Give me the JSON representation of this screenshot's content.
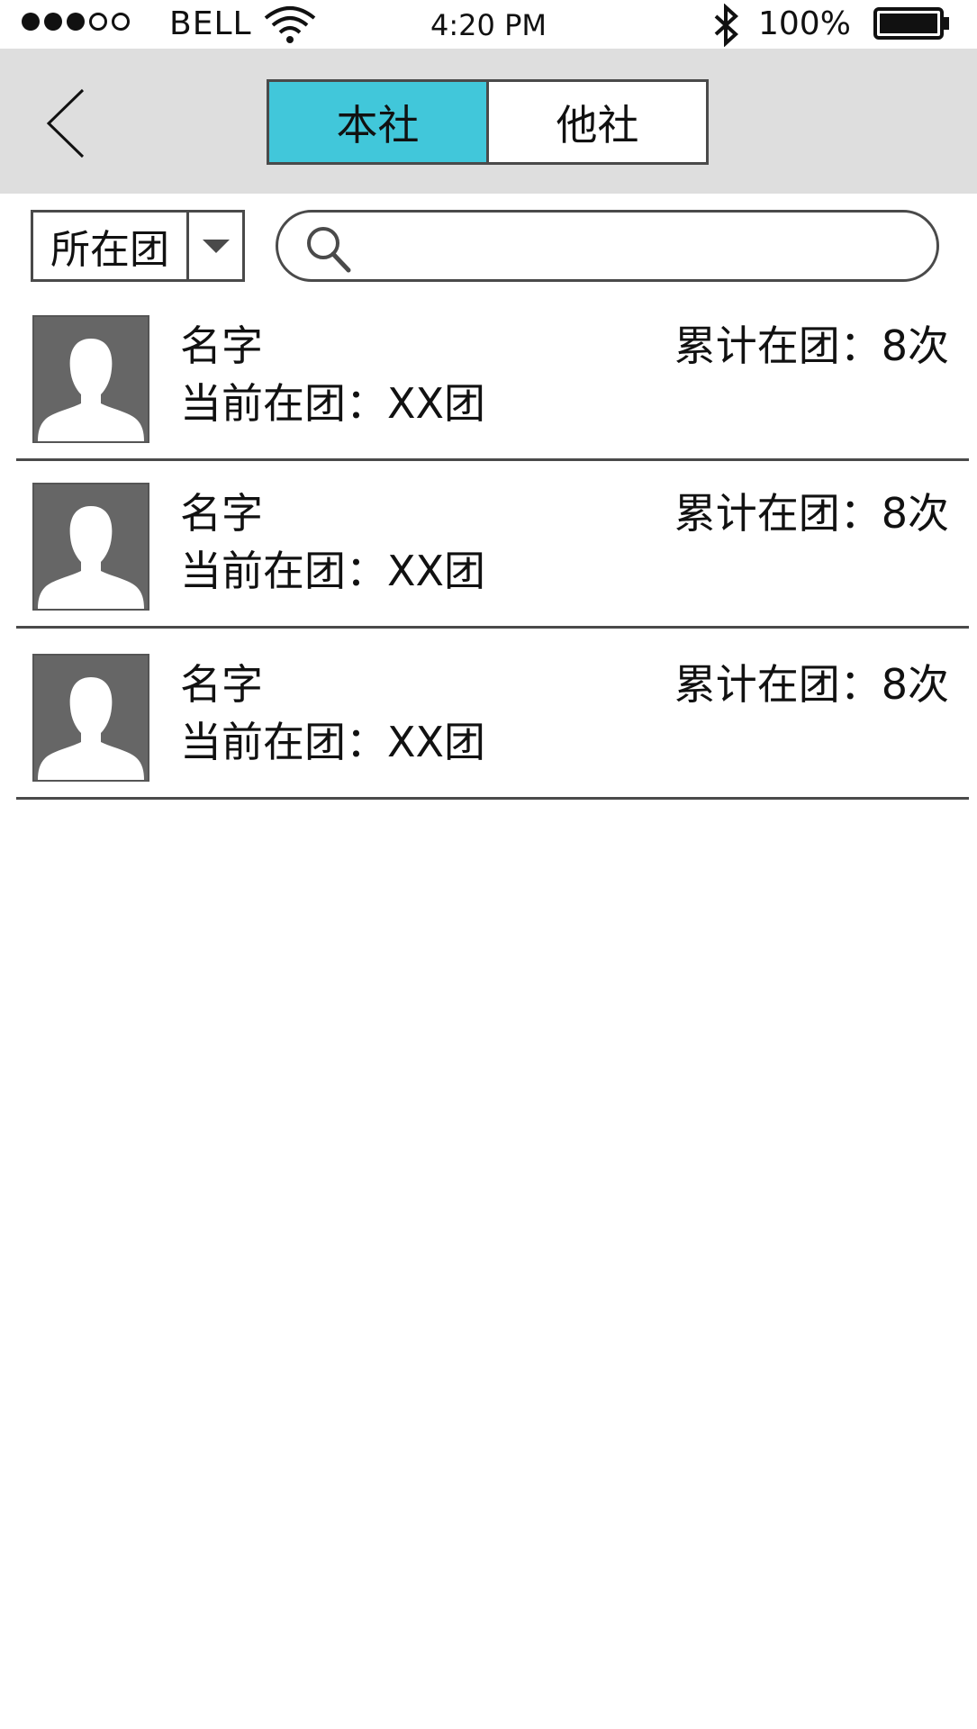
{
  "status_bar": {
    "carrier": "BELL",
    "time": "4:20 PM",
    "battery_percent": "100%",
    "signal_full": 3,
    "signal_empty": 2
  },
  "header": {
    "back_icon": "chevron-left-icon",
    "tabs": [
      {
        "label": "本社",
        "active": true
      },
      {
        "label": "他社",
        "active": false
      }
    ],
    "accent_color": "#41c7da",
    "background_color": "#dedede"
  },
  "filter": {
    "selected": "所在团",
    "dropdown_icon": "caret-down-icon"
  },
  "search": {
    "value": "",
    "placeholder": "",
    "icon": "search-icon"
  },
  "members": [
    {
      "name": "名字",
      "current_group": "当前在团：XX团",
      "total": "累计在团：8次"
    },
    {
      "name": "名字",
      "current_group": "当前在团：XX团",
      "total": "累计在团：8次"
    },
    {
      "name": "名字",
      "current_group": "当前在团：XX团",
      "total": "累计在团：8次"
    }
  ]
}
